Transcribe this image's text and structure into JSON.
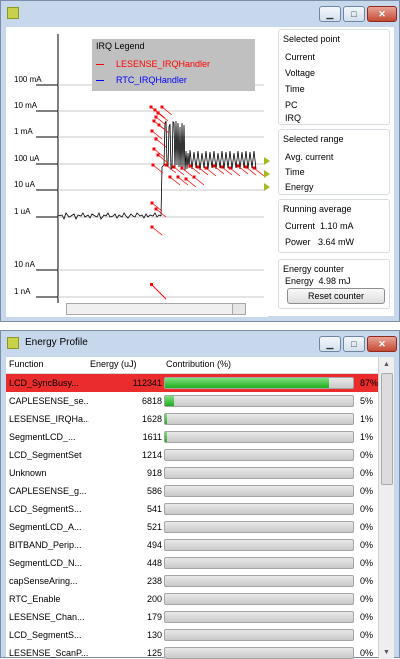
{
  "monitor": {
    "legend": {
      "title": "IRQ Legend",
      "items": [
        {
          "label": "LESENSE_IRQHandler",
          "color": "#ff0000"
        },
        {
          "label": "RTC_IRQHandler",
          "color": "#0000ff"
        }
      ]
    },
    "y_axis_labels": [
      "100 mA",
      "10 mA",
      "1 mA",
      "100 uA",
      "10 uA",
      "1 uA",
      "10 nA",
      "1 nA"
    ],
    "selected_point": {
      "title": "Selected point",
      "fields": [
        "Current",
        "Voltage",
        "Time",
        "PC",
        "IRQ"
      ]
    },
    "selected_range": {
      "title": "Selected range",
      "fields": [
        "Avg. current",
        "Time",
        "Energy"
      ]
    },
    "running_average": {
      "title": "Running average",
      "current_label": "Current",
      "current_value": "1.10 mA",
      "power_label": "Power",
      "power_value": "3.64 mW"
    },
    "energy_counter": {
      "title": "Energy counter",
      "energy_label": "Energy",
      "energy_value": "4.98 mJ",
      "reset_label": "Reset counter"
    }
  },
  "profile": {
    "title": "Energy Profile",
    "columns": {
      "function": "Function",
      "energy": "Energy (uJ)",
      "contribution": "Contribution (%)"
    },
    "rows": [
      {
        "function": "LCD_SyncBusy...",
        "energy": "112341",
        "percent": "87%",
        "fill": 0.87,
        "selected": true
      },
      {
        "function": "CAPLESENSE_se...",
        "energy": "6818",
        "percent": "5%",
        "fill": 0.05
      },
      {
        "function": "LESENSE_IRQHa...",
        "energy": "1628",
        "percent": "1%",
        "fill": 0.012
      },
      {
        "function": "SegmentLCD_...",
        "energy": "1611",
        "percent": "1%",
        "fill": 0.012
      },
      {
        "function": "LCD_SegmentSet",
        "energy": "1214",
        "percent": "0%",
        "fill": 0
      },
      {
        "function": "Unknown",
        "energy": "918",
        "percent": "0%",
        "fill": 0
      },
      {
        "function": "CAPLESENSE_g...",
        "energy": "586",
        "percent": "0%",
        "fill": 0
      },
      {
        "function": "LCD_SegmentS...",
        "energy": "541",
        "percent": "0%",
        "fill": 0
      },
      {
        "function": "SegmentLCD_A...",
        "energy": "521",
        "percent": "0%",
        "fill": 0
      },
      {
        "function": "BITBAND_Perip...",
        "energy": "494",
        "percent": "0%",
        "fill": 0
      },
      {
        "function": "SegmentLCD_N...",
        "energy": "448",
        "percent": "0%",
        "fill": 0
      },
      {
        "function": "capSenseAring...",
        "energy": "238",
        "percent": "0%",
        "fill": 0
      },
      {
        "function": "RTC_Enable",
        "energy": "200",
        "percent": "0%",
        "fill": 0
      },
      {
        "function": "LESENSE_Chan...",
        "energy": "179",
        "percent": "0%",
        "fill": 0
      },
      {
        "function": "LCD_SegmentS...",
        "energy": "130",
        "percent": "0%",
        "fill": 0
      },
      {
        "function": "LESENSE_ScanP...",
        "energy": "125",
        "percent": "0%",
        "fill": 0
      }
    ]
  }
}
